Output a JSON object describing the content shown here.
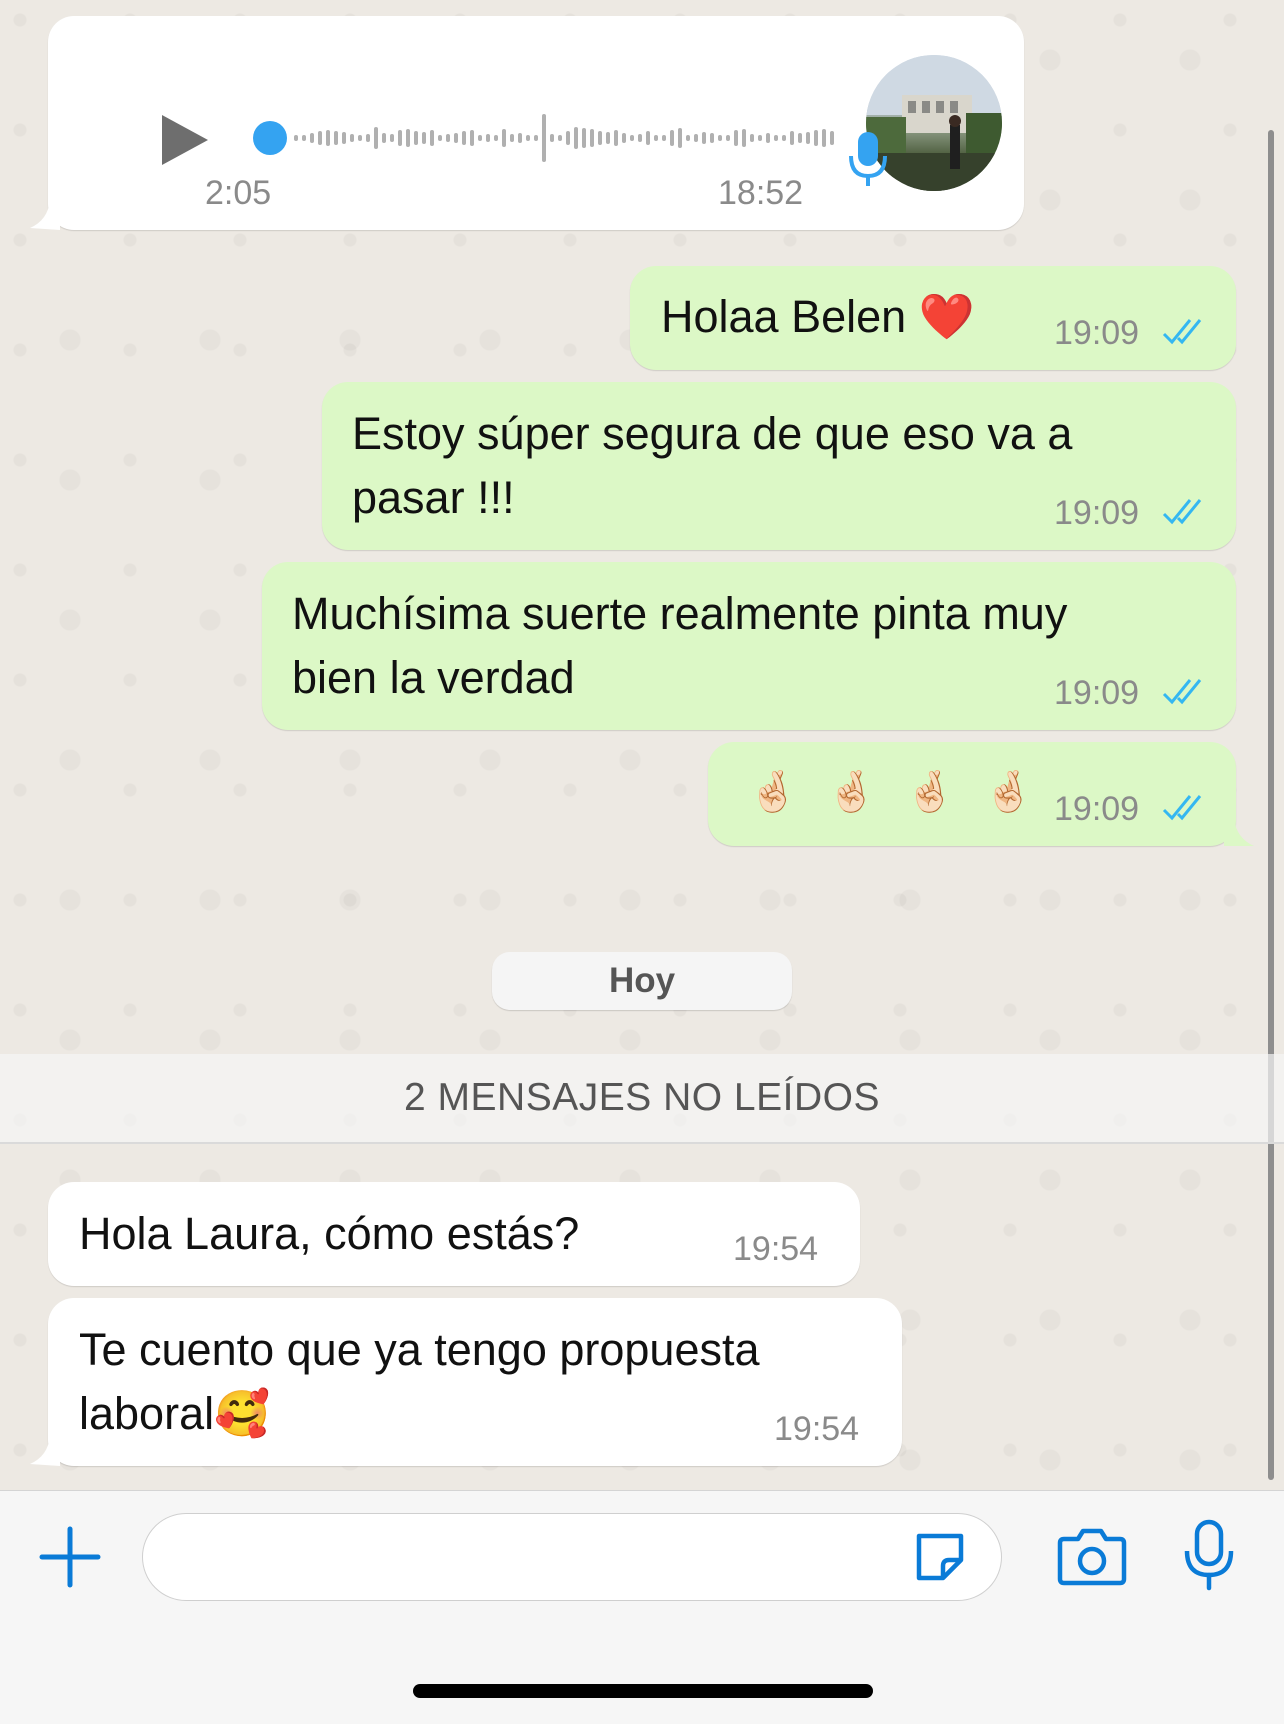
{
  "voice_message": {
    "duration": "2:05",
    "time": "18:52"
  },
  "messages_out": [
    {
      "text_lines": [
        "Holaa Belen ❤️"
      ],
      "time": "19:09"
    },
    {
      "text_lines": [
        "Estoy súper segura de que eso va a",
        "pasar !!!"
      ],
      "time": "19:09"
    },
    {
      "text_lines": [
        "Muchísima suerte realmente pinta muy",
        "bien la verdad"
      ],
      "time": "19:09"
    },
    {
      "text_lines": [
        "🤞🏻 🤞🏻 🤞🏻 🤞🏻"
      ],
      "time": "19:09"
    }
  ],
  "day_separator": "Hoy",
  "unread_banner": "2 MENSAJES NO LEÍDOS",
  "messages_in": [
    {
      "text_lines": [
        "Hola Laura, cómo estás?"
      ],
      "time": "19:54"
    },
    {
      "text_lines": [
        "Te cuento que ya tengo propuesta",
        "laboral🥰"
      ],
      "time": "19:54"
    }
  ],
  "composer": {
    "input_value": "",
    "icons": [
      "plus-icon",
      "sticker-icon",
      "camera-icon",
      "microphone-icon"
    ]
  },
  "colors": {
    "outgoing_bubble": "#DCF8C6",
    "incoming_bubble": "#FFFFFF",
    "accent_blue": "#0A7BD7",
    "read_ticks": "#34B7F1"
  }
}
